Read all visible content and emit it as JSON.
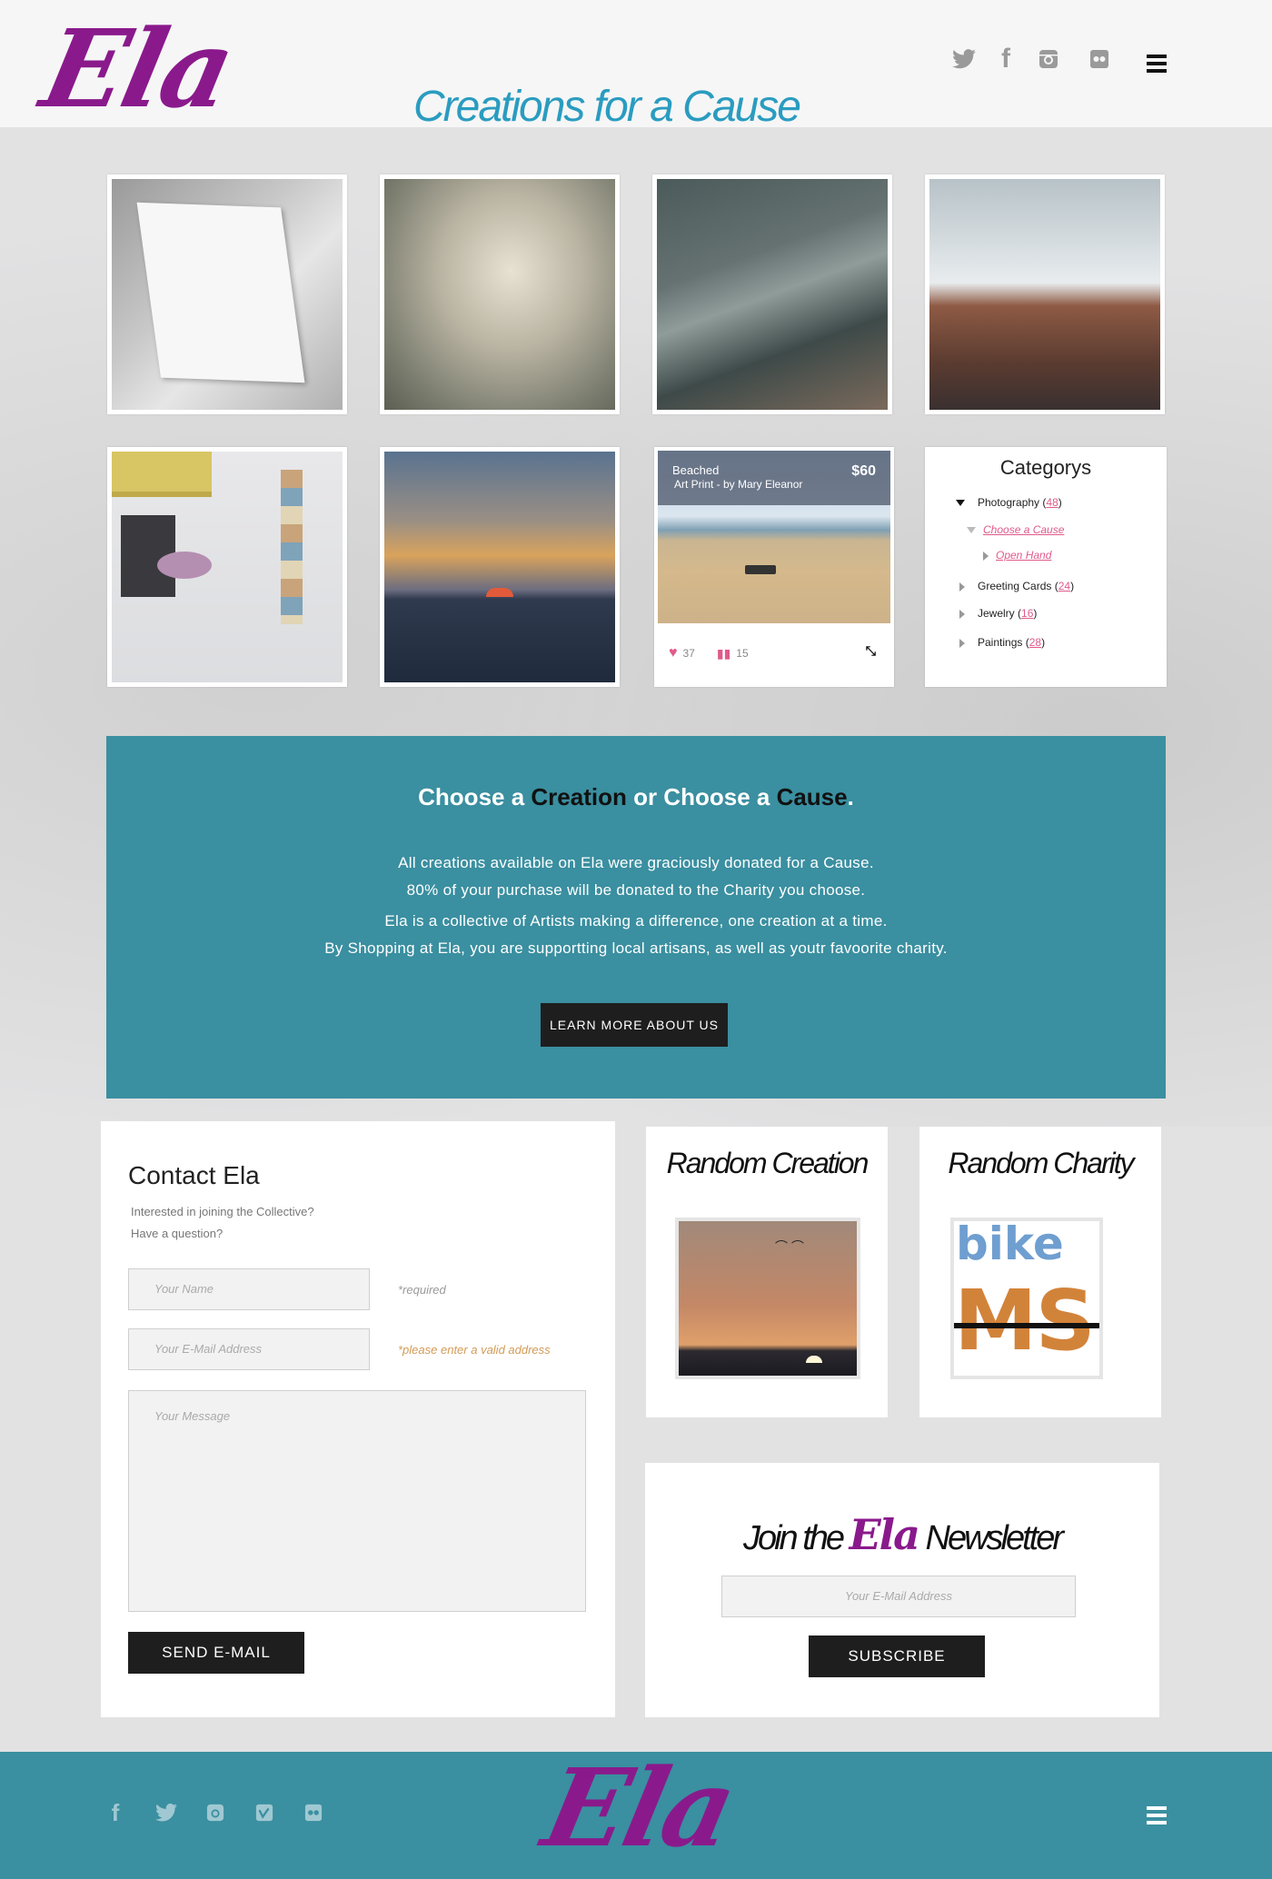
{
  "header": {
    "logo": "Ela",
    "tagline": "Creations for a Cause",
    "social_icons": [
      "twitter-icon",
      "facebook-icon",
      "instagram-icon",
      "flickr-icon"
    ],
    "menu_icon": "menu-icon"
  },
  "gallery": {
    "card": {
      "title": "Beached",
      "subtitle": "Art Print - by Mary Eleanor",
      "price": "$60",
      "likes": "37",
      "comments": "15"
    }
  },
  "categories": {
    "title": "Categorys",
    "items": [
      {
        "label": "Photography (",
        "count": "48",
        "close": ")"
      },
      {
        "label": "Choose a Cause"
      },
      {
        "label": "Open Hand"
      },
      {
        "label": "Greeting Cards (",
        "count": "24",
        "close": ")"
      },
      {
        "label": "Jewelry (",
        "count": "16",
        "close": ")"
      },
      {
        "label": "Paintings (",
        "count": "28",
        "close": ")"
      }
    ]
  },
  "banner": {
    "heading_1": "Choose a ",
    "heading_2": "Creation",
    "heading_3": " or Choose a ",
    "heading_4": "Cause",
    "heading_5": ".",
    "line1": "All creations available on Ela were graciously donated for a Cause.",
    "line2": "80% of your purchase will be donated to the Charity you choose.",
    "line3": "Ela is a collective of Artists making a difference, one creation at a time.",
    "line4": "By Shopping at Ela, you are supportting local artisans, as well as youtr favoorite charity.",
    "button": "LEARN MORE ABOUT US"
  },
  "contact": {
    "title": "Contact Ela",
    "q1": "Interested in joining the Collective?",
    "q2": "Have a question?",
    "name_placeholder": "Your Name",
    "name_hint": "*required",
    "email_placeholder": "Your E-Mail Address",
    "email_hint": "*please enter a valid address",
    "message_placeholder": "Your Message",
    "button": "SEND E-MAIL"
  },
  "random_creation": {
    "title": "Random Creation"
  },
  "random_charity": {
    "title": "Random Charity",
    "logo_top": "bike",
    "logo_bottom": "MS"
  },
  "newsletter": {
    "title_pre": "Join the ",
    "title_brand": "Ela",
    "title_post": " Newsletter",
    "placeholder": "Your E-Mail Address",
    "button": "SUBSCRIBE"
  },
  "footer": {
    "logo": "Ela",
    "social_icons": [
      "facebook-icon",
      "twitter-icon",
      "instagram-icon",
      "vimeo-icon",
      "flickr-icon"
    ]
  },
  "colors": {
    "brand": "#8a1a8c",
    "teal": "#3a8fa0",
    "accent": "#2a9cc0",
    "pink": "#e05a8a"
  }
}
